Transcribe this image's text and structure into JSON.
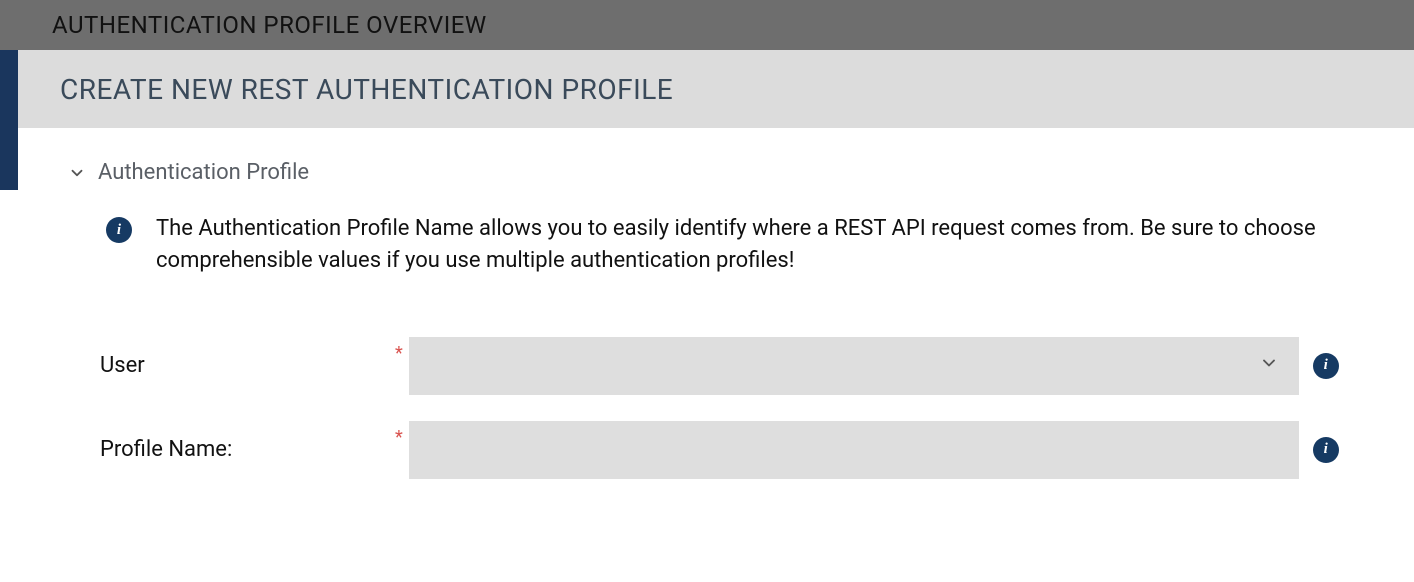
{
  "topbar": {
    "title": "AUTHENTICATION PROFILE OVERVIEW"
  },
  "subheader": {
    "title": "CREATE NEW REST AUTHENTICATION PROFILE"
  },
  "section": {
    "title": "Authentication Profile",
    "info_text": "The Authentication Profile Name allows you to easily identify where a REST API request comes from. Be sure to choose comprehensible values if you use multiple authentication profiles!"
  },
  "form": {
    "user": {
      "label": "User",
      "required_marker": "*",
      "value": ""
    },
    "profile_name": {
      "label": "Profile Name:",
      "required_marker": "*",
      "value": ""
    }
  }
}
